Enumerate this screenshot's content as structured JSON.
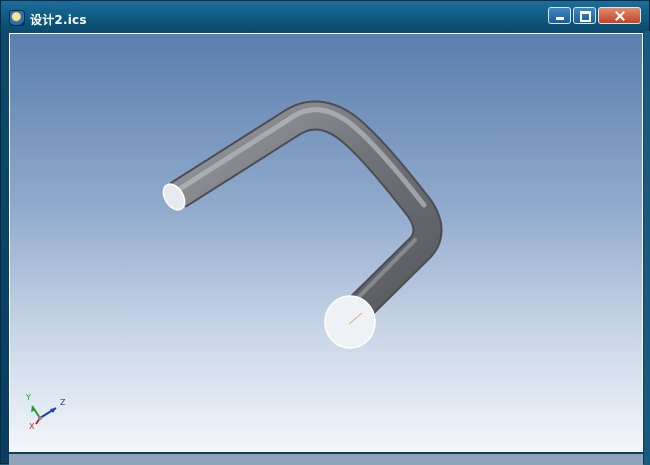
{
  "window": {
    "title": "设计2.ics",
    "icon": "app-icon",
    "controls": {
      "minimize": "minimize-icon",
      "maximize": "maximize-icon",
      "close": "close-icon"
    }
  },
  "triad": {
    "x_label": "X",
    "y_label": "Y",
    "z_label": "Z"
  },
  "colors": {
    "title_bar": "#0f5a82",
    "viewport_top": "#5a7eae",
    "viewport_bottom": "#f3f6fa",
    "pipe": "#7d8084"
  }
}
